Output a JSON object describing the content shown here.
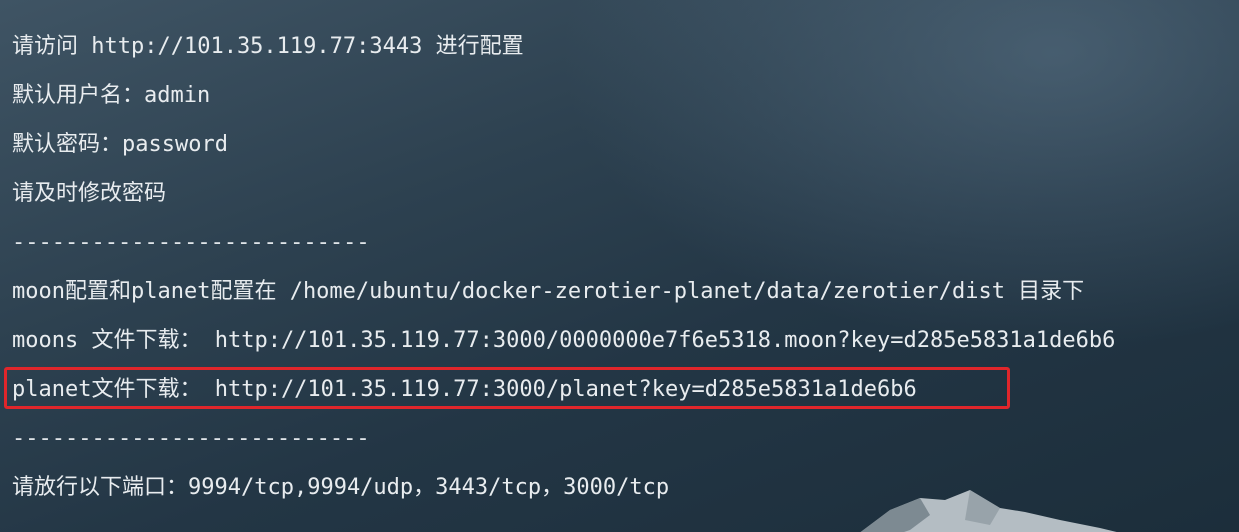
{
  "lines": {
    "sep_top": "---------------------------",
    "visit": "请访问 http://101.35.119.77:3443 进行配置",
    "username": "默认用户名：admin",
    "password": "默认密码：password",
    "change_pw": "请及时修改密码",
    "sep_mid": "---------------------------",
    "config_dir": "moon配置和planet配置在 /home/ubuntu/docker-zerotier-planet/data/zerotier/dist 目录下",
    "moons_download": "moons 文件下载： http://101.35.119.77:3000/0000000e7f6e5318.moon?key=d285e5831a1de6b6",
    "planet_download": "planet文件下载： http://101.35.119.77:3000/planet?key=d285e5831a1de6b6",
    "sep_bottom": "---------------------------",
    "ports": "请放行以下端口：9994/tcp,9994/udp，3443/tcp，3000/tcp"
  },
  "colors": {
    "text": "#e8ecef",
    "highlight": "#e0262b"
  }
}
